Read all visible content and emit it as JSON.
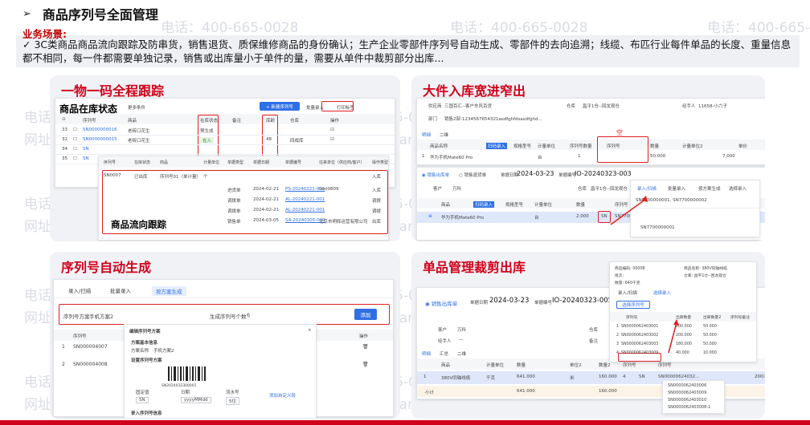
{
  "header": {
    "arrow": "➢",
    "title": "商品序列号全面管理"
  },
  "scene": {
    "label": "业务场景:",
    "text": "✓ 3C类商品商品流向跟踪及防串货，销售退货、质保维修商品的身份确认；生产企业零部件序列号自动生成、零部件的去向追溯；线缆、布匹行业每件单品的长度、重量信息都不相同，每一件都需要单独记录，销售或出库量小于单件的量，需要从单件中裁剪部分出库..."
  },
  "watermark": {
    "phone": "电话：400-665-0028",
    "site": "网址：www.chanjet.net"
  },
  "panels": {
    "p1": {
      "title": "一物一码全程跟踪",
      "overlay_stock": "商品在库状态",
      "overlay_flow": "商品流向跟踪",
      "toolbar": {
        "filter": "更多条件",
        "new_btn": "+ 新建序列号",
        "batch": "批量录入",
        "print": "打印标签"
      },
      "stock_headers": [
        "序列号",
        "商品",
        "在库状态",
        "备注",
        "库龄",
        "仓库",
        "操作"
      ],
      "stock_rows": [
        {
          "no": "33",
          "sn": "SN0000000016",
          "goods": "老砖口花生",
          "status": "预生成",
          "age": "",
          "wh": "",
          "op": "☑"
        },
        {
          "no": "32",
          "sn": "SN0000000015",
          "goods": "老砖口花生",
          "status": "在入",
          "age": "48",
          "wh": "四成库",
          "op": "☑"
        },
        {
          "no": "34",
          "sn": "SN",
          "goods": "",
          "status": "",
          "age": "",
          "wh": "",
          "op": ""
        },
        {
          "no": "35",
          "sn": "SN",
          "goods": "",
          "status": "",
          "age": "",
          "wh": "",
          "op": ""
        }
      ],
      "flow_headers": [
        "序列号",
        "在库状态",
        "商品",
        "计量单位",
        "单据类型",
        "单据日期",
        "单据编号",
        "往来单位（供应商/客户）",
        "操作类型"
      ],
      "flow_first": {
        "sn": "SN0007",
        "status": "已出库",
        "goods": "序列号01（单计量）",
        "unit": "个",
        "op": "入库"
      },
      "flow_rows": [
        {
          "type": "进货单",
          "date": "2024-02-21",
          "code": "PS-20240221-001",
          "partner": "test0809",
          "op": "入库"
        },
        {
          "type": "调拨单",
          "date": "2024-02-21",
          "code": "AL-20240221-001",
          "partner": "",
          "op": "调拨"
        },
        {
          "type": "调拨单",
          "date": "2024-02-21",
          "code": "AL-20240221-001",
          "partner": "",
          "op": "调拨"
        },
        {
          "type": "销售单",
          "date": "2024-03-05",
          "code": "SA-20240305-009",
          "partner": "北京市明辉运营有限公司",
          "op": "出库"
        }
      ]
    },
    "p2": {
      "title": "大件入库宽进窄出",
      "top_fields": {
        "supplier_label": "供应商",
        "supplier": "三国百汇--客户东风百货",
        "warehouse_label": "仓库",
        "warehouse": "昌平1仓--回龙观仓",
        "handler_label": "经手人",
        "handler": "11658-小六子",
        "dept_label": "部门",
        "dept": "销售2部-1234567654321asdfghfdsasdfghd..."
      },
      "top_tabs": [
        "明细",
        "二维"
      ],
      "top_headers": [
        "商品名称",
        "扫码录入",
        "规格型号",
        "计量单位",
        "序列号数量",
        "序列号",
        "数量",
        "计量单位2",
        "单价"
      ],
      "top_row": {
        "no": "1",
        "goods": "华为手机Mate60 Pro",
        "unit": "台",
        "sn_count": "1",
        "sn": "",
        "qty": "50.000",
        "price": "7,000"
      },
      "empty_tag": "空",
      "radios": [
        "销售出库单",
        "销售退货单"
      ],
      "date_label": "单据日期",
      "date": "2024-03-23",
      "code_label": "单据编号",
      "code": "IO-20240323-003",
      "customer_label": "客户",
      "customer": "万科",
      "wh_label": "仓库",
      "wh": "昌平1仓--回龙观仓",
      "bottom_headers": [
        "商品",
        "扫码录入",
        "规格型号",
        "计量单位",
        "数量",
        "序列号"
      ],
      "bottom_row": {
        "no": "1",
        "goods": "华为手机Mate60 Pro",
        "unit": "台",
        "qty": "2.000",
        "sn": "SN",
        "sn_full": "SN7700001..."
      },
      "popup_tabs": [
        "录入/扫描",
        "批量录入",
        "按方案生成",
        "选择录入"
      ],
      "popup_sn": "SN7700000001, SN7700000002",
      "popup_row": "SN7700000001"
    },
    "p3": {
      "title": "序列号自动生成",
      "tabs": [
        "录入/扫描",
        "批量录入",
        "按方案生成"
      ],
      "scheme_label": "序列号方案",
      "scheme_value": "手机方案2",
      "count_label": "生成序列号个数",
      "count_value": "6",
      "add_btn": "添加",
      "list_header": "序列号",
      "op_header": "操作",
      "list_rows": [
        {
          "no": "1",
          "sn": "SN000004007",
          "op": "🗑"
        },
        {
          "no": "2",
          "sn": "SN000004008",
          "op": "🗑"
        }
      ],
      "dialog": {
        "title": "编辑序列号方案",
        "section": "方案基本信息",
        "name_label": "方案名称",
        "name": "手机方案2",
        "rule_label": "设置序列号方案",
        "barcode_caption": "SN2024032300001",
        "segments": [
          "固定值",
          "日期",
          "流水号"
        ],
        "segment_values": [
          "SN",
          "yyyyMMdd",
          "5位"
        ],
        "add_seg": "添加自定义段",
        "footer": "录入序列号信息"
      }
    },
    "p4": {
      "title": "单品管理裁剪出库",
      "radio": "销售出库单",
      "date_label": "单据日期",
      "date": "2024-03-23",
      "code_label": "单据编号",
      "code": "IO-20240323-005",
      "customer_label": "客户",
      "customer": "万科",
      "handler_label": "经手人",
      "handler": "—",
      "wh_label": "仓库",
      "note_label": "备注",
      "tabs": [
        "明细",
        "汇总",
        "二维"
      ],
      "headers": [
        "商品",
        "计量单位",
        "数量",
        "单位2",
        "数量2",
        "序列号",
        "序列号"
      ],
      "row": {
        "no": "1",
        "goods": "380V同轴线缆",
        "unit": "千克",
        "qty": "641.000",
        "unit2": "米",
        "qty2": "160.000",
        "count": "4",
        "sn": "SN",
        "sn_full": "SN00000624032...",
        "extra": "200/50, 16..."
      },
      "total": {
        "label": "小计",
        "qty": "641.000",
        "qty2": "160.000"
      },
      "popup": {
        "top_fields": [
          {
            "label": "商品编码",
            "value": "00008"
          },
          {
            "label": "商品名称",
            "value": "380V同轴线缆"
          },
          {
            "label": "批次",
            "value": ""
          },
          {
            "label": "仓库",
            "value": "昌平1仓--回龙观仓"
          },
          {
            "label": "数量",
            "value": "640千克"
          }
        ],
        "tabs": [
          "录入/扫描",
          "选择录入"
        ],
        "select_btn": "选择序列号",
        "headers": [
          "序列号",
          "出库数量",
          "出库数量2",
          "序列号备注"
        ],
        "rows": [
          {
            "no": "1",
            "sn": "SN0000062403001",
            "q1": "200.000",
            "q2": "50.000"
          },
          {
            "no": "2",
            "sn": "SN0000062403002",
            "q1": "200.000",
            "q2": "50.000"
          },
          {
            "no": "3",
            "sn": "SN0000062403003",
            "q1": "180.000",
            "q2": "50.000"
          },
          {
            "no": "4",
            "sn": "SN0000062403009",
            "q1": "40.000",
            "q2": "10.000"
          }
        ],
        "dropdown": [
          "SN0000062403006",
          "SN0000062403009",
          "SN0000062403010",
          "SN0000062403008-1"
        ]
      }
    }
  }
}
